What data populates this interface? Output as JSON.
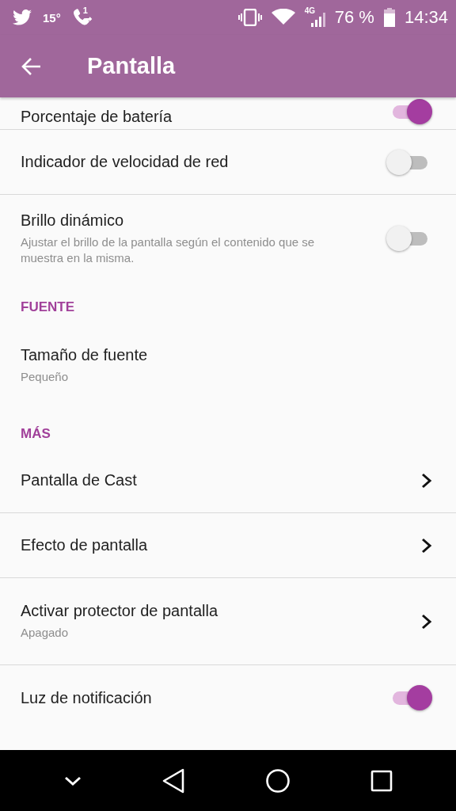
{
  "status_bar": {
    "temperature": "15°",
    "call_count": "1",
    "network": "4G",
    "battery": "76 %",
    "time": "14:34"
  },
  "app_bar": {
    "title": "Pantalla"
  },
  "sections": [
    {
      "items": [
        {
          "kind": "toggle",
          "title": "Porcentaje de batería",
          "on": true
        },
        {
          "kind": "toggle",
          "title": "Indicador de velocidad de red",
          "on": false
        },
        {
          "kind": "toggle",
          "title": "Brillo dinámico",
          "summary": "Ajustar el brillo de la pantalla según el contenido que se muestra en la misma.",
          "on": false
        }
      ]
    },
    {
      "header": "FUENTE",
      "items": [
        {
          "kind": "plain",
          "title": "Tamaño de fuente",
          "summary": "Pequeño"
        }
      ]
    },
    {
      "header": "MÁS",
      "items": [
        {
          "kind": "chevron",
          "title": "Pantalla de Cast"
        },
        {
          "kind": "chevron",
          "title": "Efecto de pantalla"
        },
        {
          "kind": "chevron",
          "title": "Activar protector de pantalla",
          "summary": "Apagado"
        },
        {
          "kind": "toggle",
          "title": "Luz de notificación",
          "on": true
        }
      ]
    }
  ]
}
